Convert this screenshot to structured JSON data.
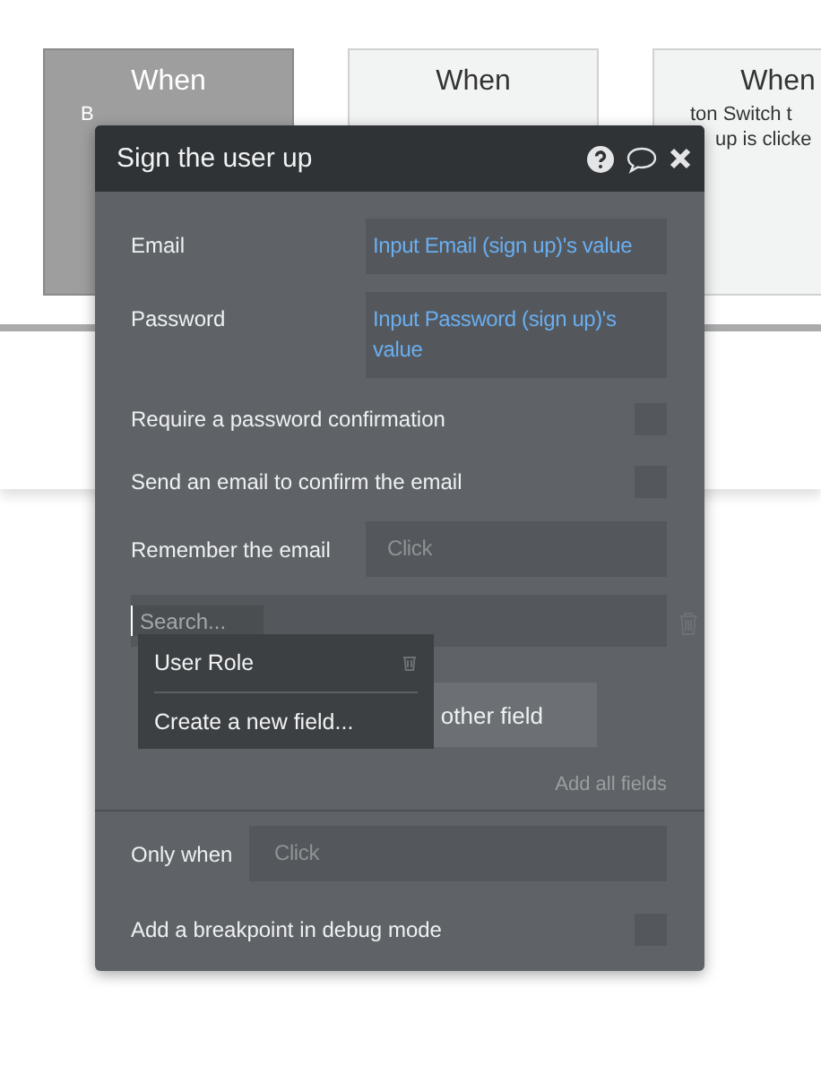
{
  "background_cards": [
    {
      "title": "When",
      "lines": [
        "B"
      ],
      "selected": true
    },
    {
      "title": "When",
      "selected": false
    },
    {
      "title": "When",
      "lines": [
        "ton Switch t",
        "up is clicke"
      ],
      "selected": false
    }
  ],
  "dialog": {
    "title": "Sign the user up",
    "fields": [
      {
        "label": "Email",
        "value": "Input Email (sign up)'s value"
      },
      {
        "label": "Password",
        "value": "Input Password (sign up)'s value"
      }
    ],
    "options": [
      {
        "kind": "checkbox",
        "label": "Require a password confirmation",
        "checked": false
      },
      {
        "kind": "checkbox",
        "label": "Send an email to confirm the email",
        "checked": false
      },
      {
        "kind": "dropdown",
        "label": "Remember the email",
        "placeholder": "Click"
      }
    ],
    "field_picker": {
      "search_placeholder": "Search...",
      "items": [
        {
          "kind": "field",
          "label": "User Role"
        },
        {
          "kind": "action",
          "label": "Create a new field..."
        }
      ]
    },
    "add_field_button": "other field",
    "add_all_link": "Add all fields",
    "only_when": {
      "label": "Only when",
      "placeholder": "Click"
    },
    "breakpoint": {
      "label": "Add a breakpoint in debug mode",
      "checked": false
    }
  }
}
